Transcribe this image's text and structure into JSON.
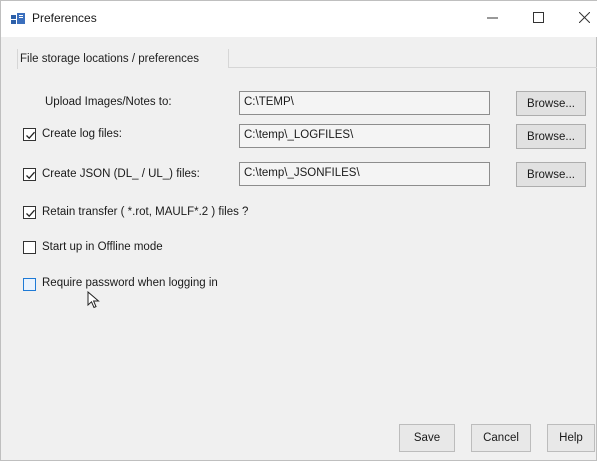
{
  "window": {
    "title": "Preferences",
    "minimize_glyph": "—",
    "maximize_glyph": "☐",
    "close_glyph": "✕"
  },
  "section": {
    "header": "File storage locations / preferences"
  },
  "rows": {
    "upload": {
      "label": "Upload Images/Notes to:",
      "value": "C:\\TEMP\\",
      "browse": "Browse..."
    },
    "log": {
      "label": "Create log files:",
      "checked": true,
      "value": "C:\\temp\\_LOGFILES\\",
      "browse": "Browse..."
    },
    "json": {
      "label": "Create JSON (DL_ / UL_) files:",
      "checked": true,
      "value": "C:\\temp\\_JSONFILES\\",
      "browse": "Browse..."
    }
  },
  "options": {
    "retain": {
      "label": "Retain transfer ( *.rot, MAULF*.2 ) files ?",
      "checked": true
    },
    "offline": {
      "label": "Start up in Offline mode",
      "checked": false
    },
    "password": {
      "label": "Require password when logging in",
      "checked": false,
      "focused": true
    }
  },
  "footer": {
    "save": "Save",
    "cancel": "Cancel",
    "help": "Help"
  },
  "colors": {
    "window_bg": "#f0f0f0",
    "titlebar_bg": "#ffffff",
    "focus_accent": "#1e7ad6"
  },
  "icons": {
    "app": "app-icon",
    "minimize": "minimize-icon",
    "maximize": "maximize-icon",
    "close": "close-icon",
    "check": "checkmark-icon",
    "cursor": "mouse-pointer-icon"
  }
}
